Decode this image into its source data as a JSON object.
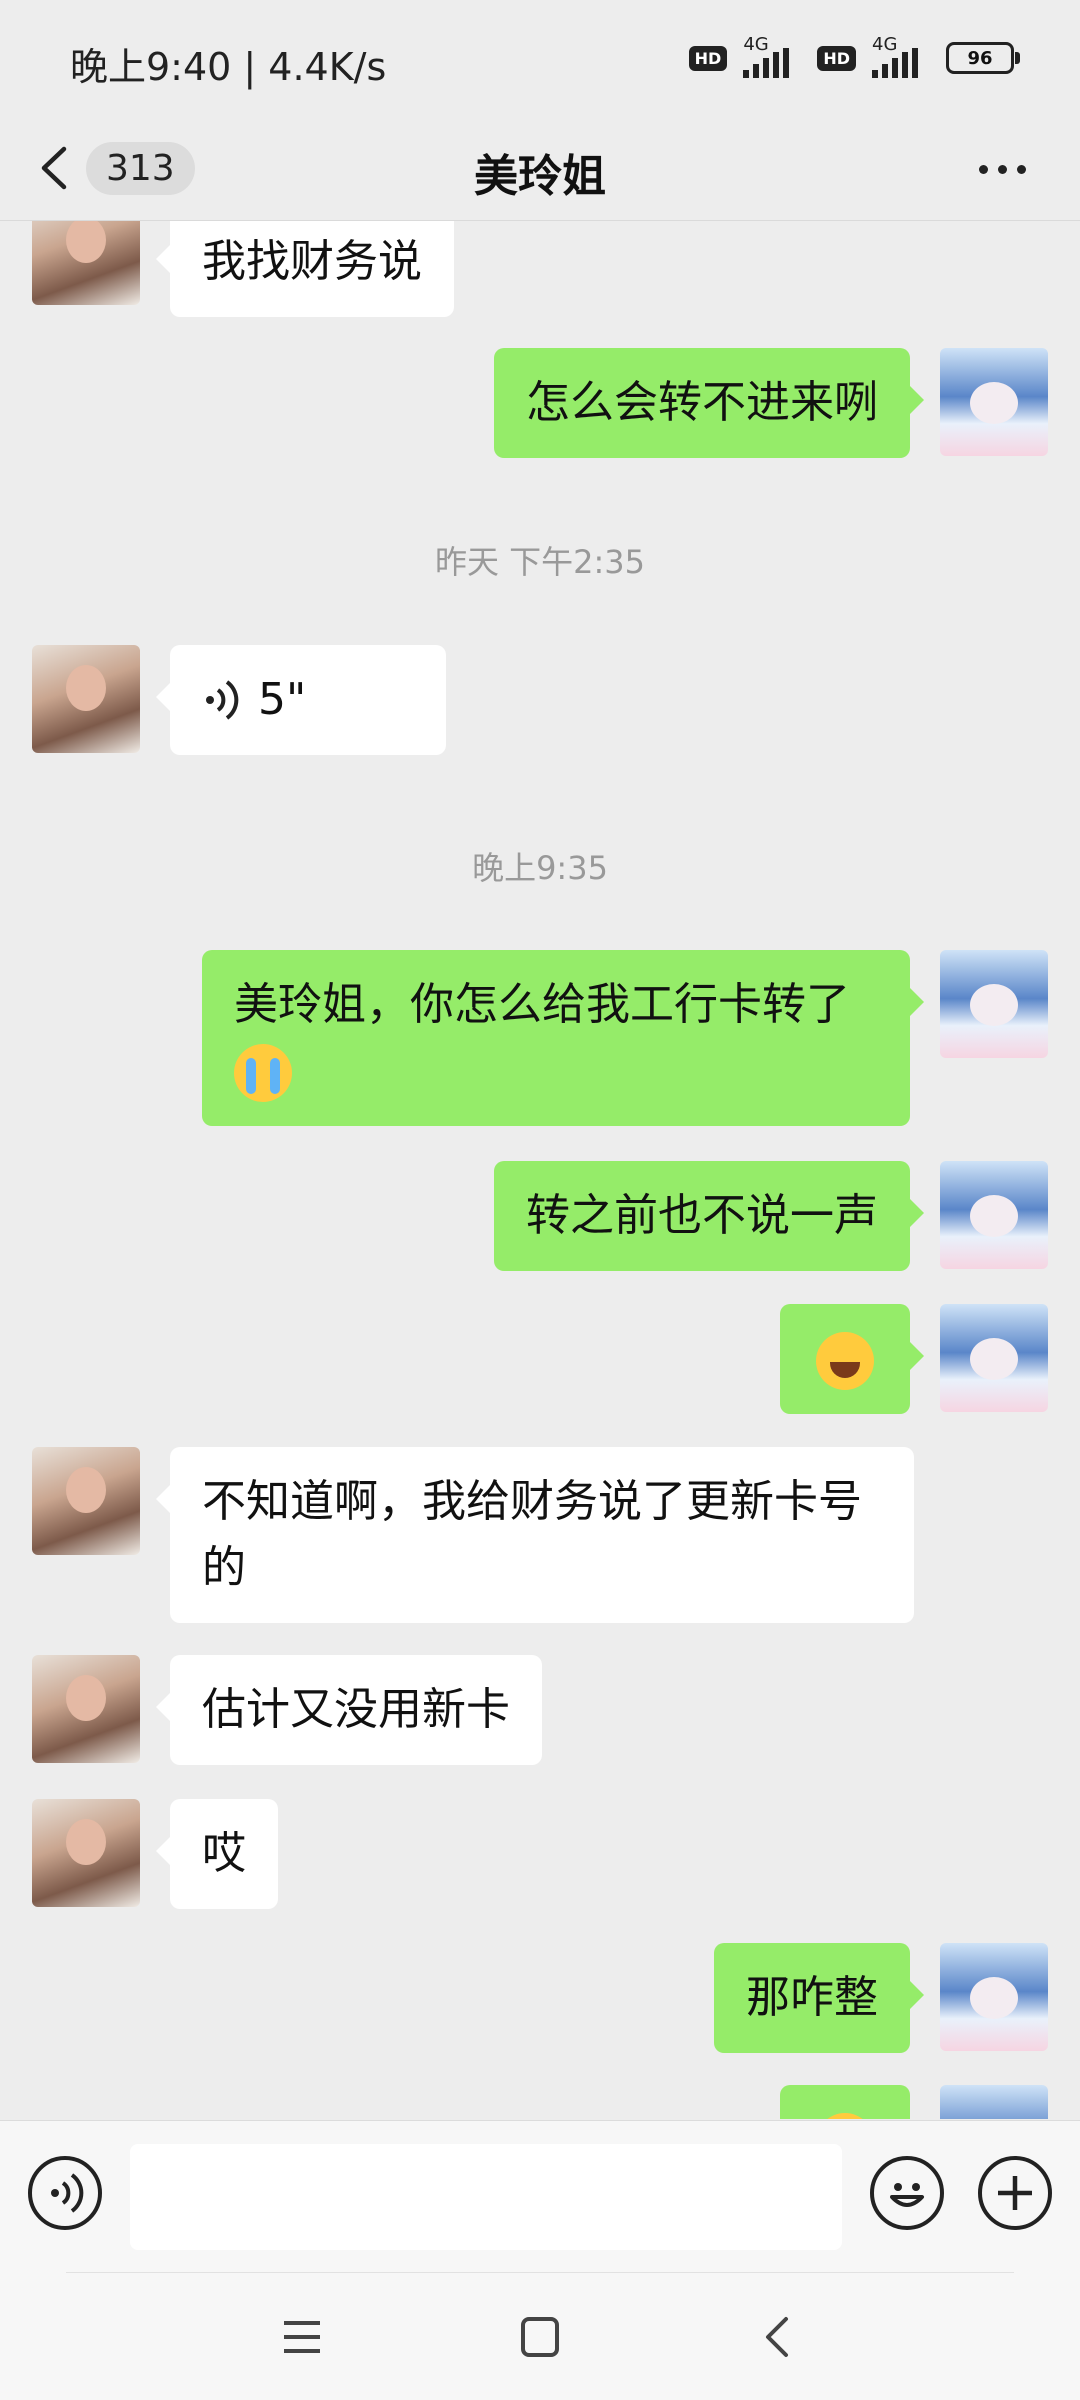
{
  "status_bar": {
    "time_speed": "晚上9:40 | 4.4K/s",
    "sim1": {
      "hd": "HD",
      "network": "4G"
    },
    "sim2": {
      "hd": "HD",
      "network": "4G"
    },
    "battery": "96"
  },
  "header": {
    "unread_count": "313",
    "title": "美玲姐",
    "back_icon": "chevron-left-icon",
    "more_icon": "more-dots-icon"
  },
  "colors": {
    "outgoing_bubble": "#95ec69",
    "incoming_bubble": "#ffffff",
    "background": "#ededed"
  },
  "messages": [
    {
      "side": "left",
      "text": "我找财务说"
    },
    {
      "side": "right",
      "text": "怎么会转不进来咧"
    },
    {
      "type": "timestamp",
      "text": "昨天 下午2:35"
    },
    {
      "side": "left",
      "type": "voice",
      "duration": "5\""
    },
    {
      "type": "timestamp",
      "text": "晚上9:35"
    },
    {
      "side": "right",
      "text": "美玲姐，你怎么给我工行卡转了",
      "emoji": "crying-face-emoji"
    },
    {
      "side": "right",
      "text": "转之前也不说一声"
    },
    {
      "side": "right",
      "type": "emoji",
      "emoji": "laughing-tears-emoji"
    },
    {
      "side": "left",
      "text": "不知道啊，我给财务说了更新卡号的"
    },
    {
      "side": "left",
      "text": "估计又没用新卡"
    },
    {
      "side": "left",
      "text": "哎"
    },
    {
      "side": "right",
      "text": "那咋整"
    }
  ],
  "input_bar": {
    "voice_icon": "voice-input-icon",
    "emoji_icon": "emoji-icon",
    "plus_icon": "plus-icon"
  },
  "system_nav": {
    "menu_icon": "menu-icon",
    "home_icon": "home-icon",
    "back_icon": "back-icon"
  }
}
